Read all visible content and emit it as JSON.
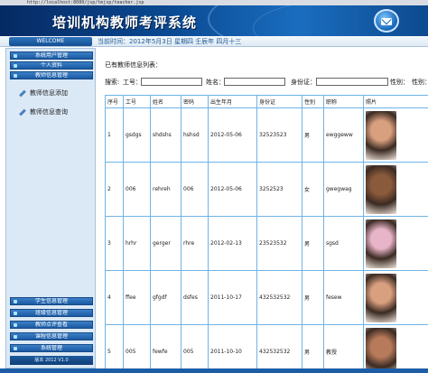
{
  "browser": {
    "url": "http://localhost:8080/jsp/tmjsp/teacher.jsp"
  },
  "header": {
    "title": "培训机构教师考评系统",
    "mail_icon": "mail-icon"
  },
  "statusbar": {
    "welcome": "WELCOME",
    "current_time": "当前时间：2012年5月3日 星期四 壬辰年 四月十三"
  },
  "sidebar": {
    "top_items": [
      {
        "label": "系统用户管理",
        "icon": "folder-icon"
      },
      {
        "label": "个人资料",
        "icon": "folder-icon"
      },
      {
        "label": "教师信息管理",
        "icon": "folder-icon"
      }
    ],
    "sub_items": [
      {
        "label": "教师信息添加",
        "icon": "pencil-icon"
      },
      {
        "label": "教师信息查询",
        "icon": "pencil-icon"
      }
    ],
    "bottom_items": [
      {
        "label": "学生信息管理",
        "icon": "folder-icon"
      },
      {
        "label": "班级信息管理",
        "icon": "folder-icon"
      },
      {
        "label": "教师点评查看",
        "icon": "folder-icon"
      },
      {
        "label": "课程信息管理",
        "icon": "folder-icon"
      },
      {
        "label": "系统管理",
        "icon": "folder-icon"
      }
    ],
    "copyright": "版本 2012 V1.0"
  },
  "main": {
    "section_title": "已有教师信息列表：",
    "search": {
      "label": "搜索:",
      "id_label": "工号：",
      "name_label": "姓名：",
      "idcard_label": "身份证：",
      "gender_label": "性别：",
      "title_label": "性别："
    },
    "table": {
      "headers": [
        "序号",
        "工号",
        "姓名",
        "密码",
        "出生年月",
        "身份证",
        "性别",
        "职称",
        "照片"
      ],
      "rows": [
        {
          "no": "1",
          "id": "gsdgs",
          "name": "shdshs",
          "password": "hshsd",
          "birth": "2012-05-06",
          "idcard": "32523523",
          "gender": "男",
          "title": "ewggeww",
          "photo": "#d9a07f"
        },
        {
          "no": "2",
          "id": "006",
          "name": "rehreh",
          "password": "006",
          "birth": "2012-05-06",
          "idcard": "3252523",
          "gender": "女",
          "title": "gwegwag",
          "photo": "#8a5a3c"
        },
        {
          "no": "3",
          "id": "hrhr",
          "name": "gerger",
          "password": "rhre",
          "birth": "2012-02-13",
          "idcard": "23523532",
          "gender": "男",
          "title": "sgsd",
          "photo": "#e8b4c8"
        },
        {
          "no": "4",
          "id": "ffee",
          "name": "gfgdf",
          "password": "dsfes",
          "birth": "2011-10-17",
          "idcard": "432532532",
          "gender": "男",
          "title": "fesew",
          "photo": "#d9a07f"
        },
        {
          "no": "5",
          "id": "005",
          "name": "fewfe",
          "password": "005",
          "birth": "2011-10-10",
          "idcard": "432532532",
          "gender": "男",
          "title": "教授",
          "photo": "#b77a5a"
        }
      ]
    }
  }
}
